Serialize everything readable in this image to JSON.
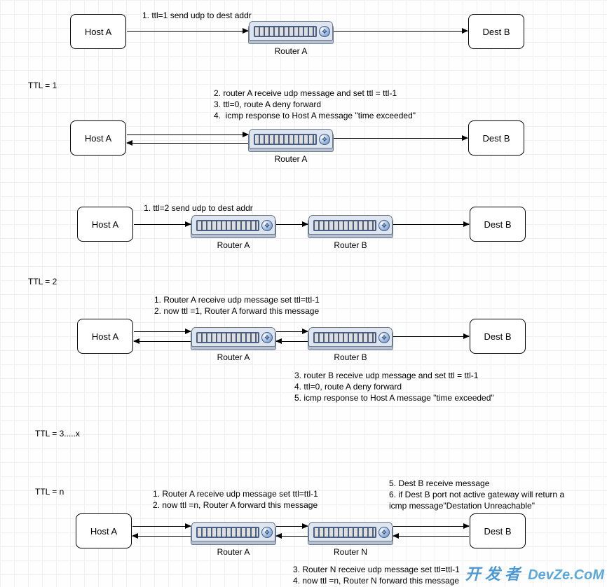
{
  "labels": {
    "ttl1": "TTL = 1",
    "ttl2": "TTL = 2",
    "ttl3x": "TTL = 3.....x",
    "ttln": "TTL = n",
    "hostA": "Host A",
    "destB": "Dest B",
    "routerA": "Router A",
    "routerB": "Router B",
    "routerN": "Router N"
  },
  "row1": {
    "msg1": "1. ttl=1 send udp to dest addr"
  },
  "row2": {
    "msg": "2. router A receive udp message and set ttl = ttl-1\n3. ttl=0, route A deny forward\n4.  icmp response to Host A message \"time exceeded\""
  },
  "row3": {
    "msg1": "1. ttl=2 send udp to dest addr"
  },
  "row4": {
    "msgTop": "1. Router A receive udp message set ttl=ttl-1\n2. now ttl =1, Router A forward this message",
    "msgBot": "3. router B receive udp message and set ttl = ttl-1\n4. ttl=0, route A deny forward\n5. icmp response to Host A message \"time exceeded\""
  },
  "row5": {
    "msgTopLeft": "1. Router A receive udp message set ttl=ttl-1\n2. now ttl =n, Router A forward this message",
    "msgTopRight": "5. Dest B receive message\n6. if Dest B port not active gateway will return a\nicmp message\"Destation Unreachable\"",
    "msgBot": "3. Router N receive udp message set ttl=ttl-1\n4. now ttl =n, Router N forward this message"
  },
  "watermark": "开 发 者  DevZe.CoM"
}
